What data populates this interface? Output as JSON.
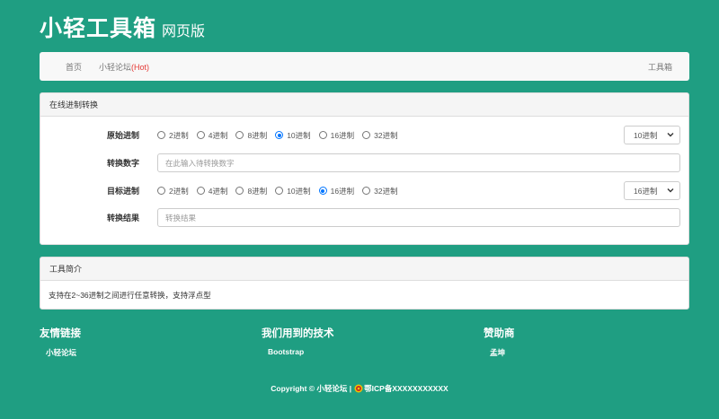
{
  "header": {
    "title": "小轻工具箱",
    "subtitle": "网页版"
  },
  "nav": {
    "home": "首页",
    "forum": "小轻论坛",
    "forum_hot": "(Hot)",
    "toolbox": "工具箱"
  },
  "converter": {
    "heading": "在线进制转换",
    "source_label": "原始进制",
    "source_options": [
      "2进制",
      "4进制",
      "8进制",
      "10进制",
      "16进制",
      "32进制"
    ],
    "source_selected_index": 3,
    "source_select_value": "10进制",
    "number_label": "转换数字",
    "number_placeholder": "在此输入待转换数字",
    "target_label": "目标进制",
    "target_options": [
      "2进制",
      "4进制",
      "8进制",
      "10进制",
      "16进制",
      "32进制"
    ],
    "target_selected_index": 4,
    "target_select_value": "16进制",
    "result_label": "转换结果",
    "result_placeholder": "转换结果"
  },
  "intro": {
    "heading": "工具简介",
    "text": "支持在2~36进制之间进行任意转换，支持浮点型"
  },
  "footer": {
    "links_heading": "友情链接",
    "links_item": "小轻论坛",
    "tech_heading": "我们用到的技术",
    "tech_item": "Bootstrap",
    "sponsor_heading": "赞助商",
    "sponsor_item": "孟坤",
    "copyright_prefix": "Copyright © 小轻论坛 |",
    "icp": "鄂ICP备XXXXXXXXXXX"
  },
  "colors": {
    "background": "#1f9e82",
    "radio_accent": "#0075ff",
    "hot": "#e53935"
  }
}
